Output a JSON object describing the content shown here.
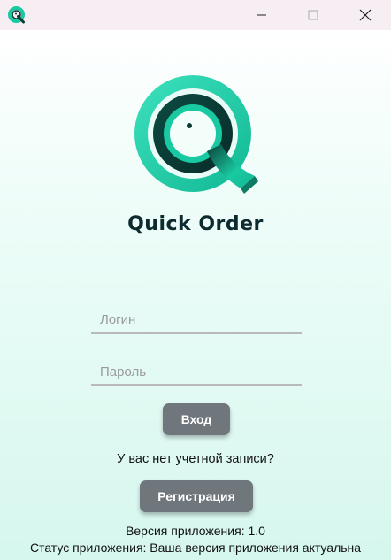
{
  "window": {
    "icon": "quick-order-logo-icon",
    "controls": [
      "minimize-icon",
      "maximize-icon",
      "close-icon"
    ]
  },
  "brand": {
    "logo": "quick-order-logo",
    "name": "Quick Order",
    "accent_color": "#19c9a1",
    "dark_color": "#0d2b2f"
  },
  "form": {
    "login_placeholder": "Логин",
    "password_placeholder": "Пароль",
    "login_button": "Вход",
    "no_account_text": "У вас нет учетной записи?",
    "register_button": "Регистрация"
  },
  "footer": {
    "version": "Версия приложения: 1.0",
    "status": "Статус приложения: Ваша версия приложения актуальна"
  }
}
